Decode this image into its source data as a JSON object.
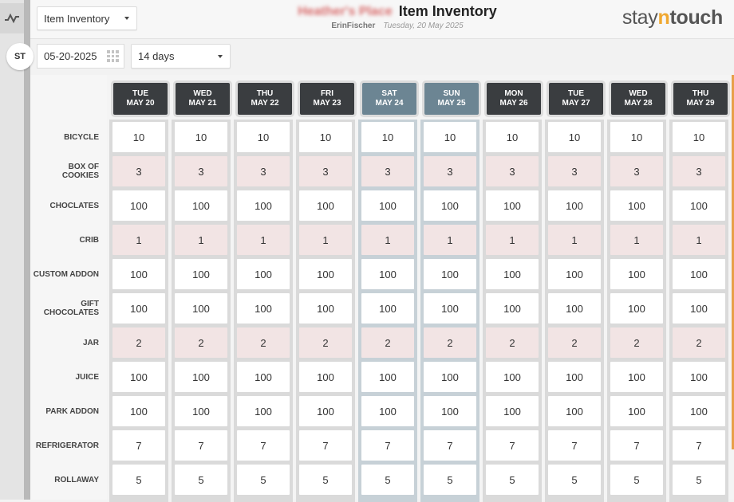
{
  "header": {
    "report_select": "Item Inventory",
    "hotel_name": "Heather's Place",
    "title": "Item Inventory",
    "user": "ErinFischer",
    "date": "Tuesday, 20 May 2025",
    "logo": {
      "part1": "stay",
      "part2": "n",
      "part3": "touch"
    }
  },
  "rail": {
    "pill_label": "ST"
  },
  "filters": {
    "date": "05-20-2025",
    "range": "14 days"
  },
  "days": [
    {
      "dow": "TUE",
      "date": "MAY 20",
      "weekend": false
    },
    {
      "dow": "WED",
      "date": "MAY 21",
      "weekend": false
    },
    {
      "dow": "THU",
      "date": "MAY 22",
      "weekend": false
    },
    {
      "dow": "FRI",
      "date": "MAY 23",
      "weekend": false
    },
    {
      "dow": "SAT",
      "date": "MAY 24",
      "weekend": true
    },
    {
      "dow": "SUN",
      "date": "MAY 25",
      "weekend": true
    },
    {
      "dow": "MON",
      "date": "MAY 26",
      "weekend": false
    },
    {
      "dow": "TUE",
      "date": "MAY 27",
      "weekend": false
    },
    {
      "dow": "WED",
      "date": "MAY 28",
      "weekend": false
    },
    {
      "dow": "THU",
      "date": "MAY 29",
      "weekend": false
    }
  ],
  "rows": [
    {
      "label": "BICYCLE",
      "value": "10",
      "highlight": false
    },
    {
      "label": "BOX OF COOKIES",
      "value": "3",
      "highlight": true
    },
    {
      "label": "CHOCLATES",
      "value": "100",
      "highlight": false
    },
    {
      "label": "CRIB",
      "value": "1",
      "highlight": true
    },
    {
      "label": "CUSTOM ADDON",
      "value": "100",
      "highlight": false
    },
    {
      "label": "GIFT CHOCOLATES",
      "value": "100",
      "highlight": false
    },
    {
      "label": "JAR",
      "value": "2",
      "highlight": true
    },
    {
      "label": "JUICE",
      "value": "100",
      "highlight": false
    },
    {
      "label": "PARK ADDON",
      "value": "100",
      "highlight": false
    },
    {
      "label": "REFRIGERATOR",
      "value": "7",
      "highlight": false
    },
    {
      "label": "ROLLAWAY",
      "value": "5",
      "highlight": false
    }
  ]
}
